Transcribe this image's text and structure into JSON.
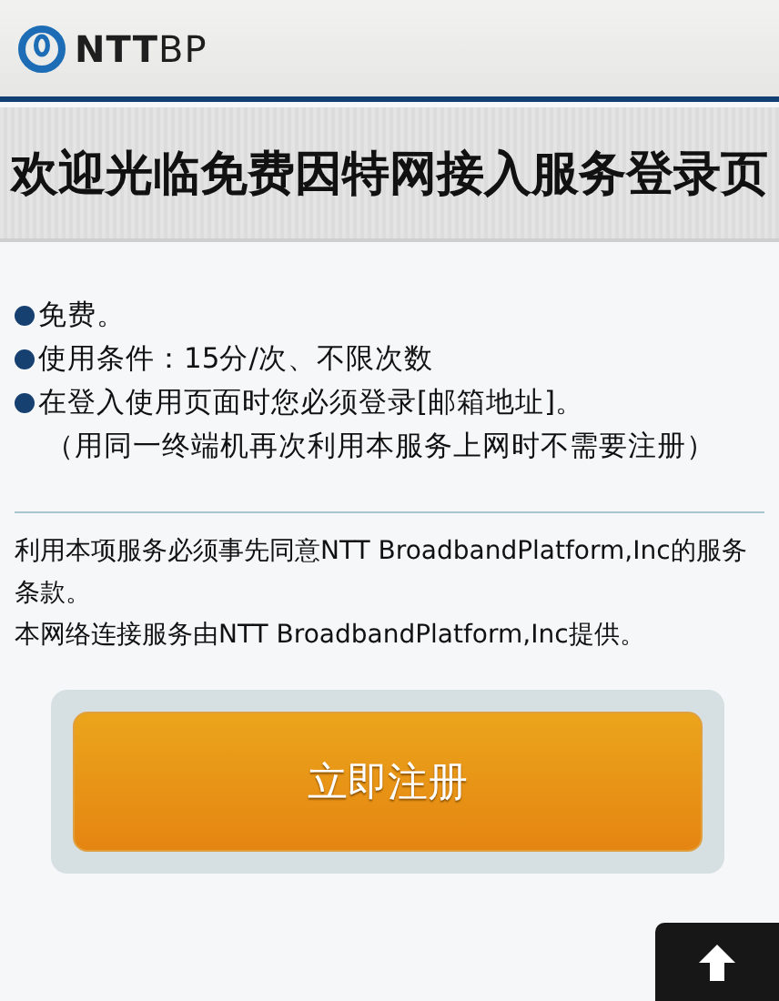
{
  "header": {
    "logo": "**NTT**BP"
  },
  "title": "欢迎光临免费因特网接入服务登录页",
  "bullets": [
    "免费。",
    "使用条件：15分/次、不限次数",
    "在登入使用页面时您必须登录[邮箱地址]。"
  ],
  "note": "（用同一终端机再次利用本服务上网时不需要注册）",
  "terms": [
    "利用本项服务必须事先同意NTT BroadbandPlatform,Inc的服务条款。",
    "本网络连接服务由NTT BroadbandPlatform,Inc提供。"
  ],
  "register_button": "立即注册",
  "back_to_top": {
    "kind": "arrow-up"
  }
}
